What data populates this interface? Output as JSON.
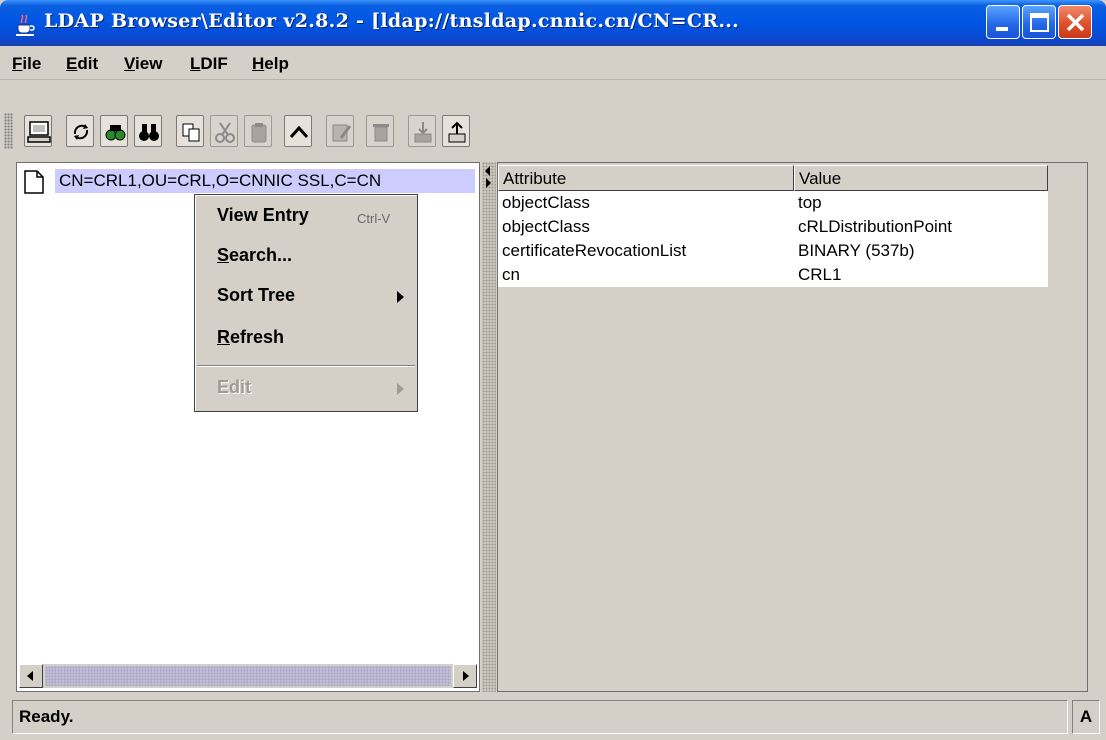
{
  "window": {
    "title": "LDAP Browser\\Editor v2.8.2 - [ldap://tnsldap.cnnic.cn/CN=CR...",
    "app_icon": "java-cup-icon",
    "controls": [
      "minimize-icon",
      "maximize-icon",
      "close-icon"
    ]
  },
  "menubar": {
    "items": [
      {
        "mnemonic": "F",
        "rest": "ile"
      },
      {
        "mnemonic": "E",
        "rest": "dit"
      },
      {
        "mnemonic": "V",
        "rest": "iew"
      },
      {
        "mnemonic": "L",
        "rest": "DIF"
      },
      {
        "mnemonic": "H",
        "rest": "elp"
      }
    ]
  },
  "toolbar": {
    "buttons": [
      {
        "icon": "connect-computer-icon",
        "enabled": true
      },
      {
        "icon": "refresh-icon",
        "enabled": true
      },
      {
        "icon": "search-binoculars-color-icon",
        "enabled": true
      },
      {
        "icon": "binoculars-icon",
        "enabled": true
      },
      {
        "icon": "copy-icon",
        "enabled": true
      },
      {
        "icon": "cut-icon",
        "enabled": false
      },
      {
        "icon": "paste-icon",
        "enabled": false
      },
      {
        "icon": "up-level-icon",
        "enabled": true
      },
      {
        "icon": "edit-entry-icon",
        "enabled": false
      },
      {
        "icon": "delete-icon",
        "enabled": false
      },
      {
        "icon": "import-icon",
        "enabled": false
      },
      {
        "icon": "export-icon",
        "enabled": true
      }
    ]
  },
  "tree": {
    "selected_entry": "CN=CRL1,OU=CRL,O=CNNIC SSL,C=CN"
  },
  "context_menu": {
    "view_entry": "View Entry",
    "view_entry_accel": "Ctrl-V",
    "search_mnemonic": "S",
    "search_rest": "earch...",
    "sort_tree": "Sort Tree",
    "refresh_mnemonic": "R",
    "refresh_rest": "efresh",
    "edit": "Edit"
  },
  "attributes_table": {
    "headers": {
      "attribute": "Attribute",
      "value": "Value"
    },
    "rows": [
      {
        "attribute": "objectClass",
        "value": "top"
      },
      {
        "attribute": "objectClass",
        "value": "cRLDistributionPoint"
      },
      {
        "attribute": "certificateRevocationList",
        "value": "BINARY (537b)"
      },
      {
        "attribute": "cn",
        "value": "CRL1"
      }
    ]
  },
  "status": {
    "text": "Ready.",
    "mode": "A"
  }
}
